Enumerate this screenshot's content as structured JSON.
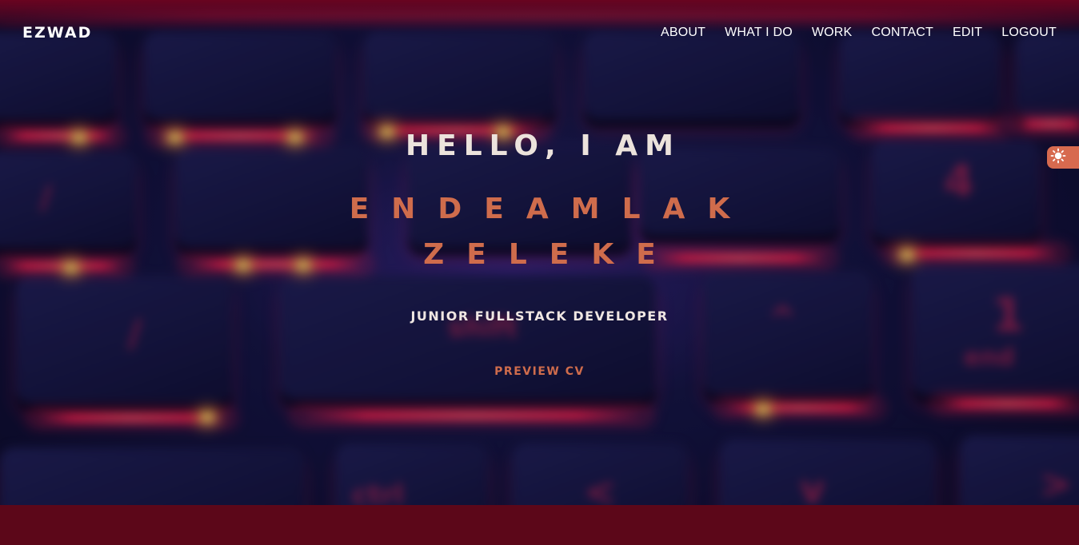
{
  "nav": {
    "brand": "EZWAD",
    "items": [
      {
        "label": "ABOUT"
      },
      {
        "label": "WHAT I DO"
      },
      {
        "label": "WORK"
      },
      {
        "label": "CONTACT"
      },
      {
        "label": "EDIT"
      },
      {
        "label": "LOGOUT"
      }
    ]
  },
  "theme_toggle": {
    "icon": "sun-icon"
  },
  "hero": {
    "greeting": "HELLO, I AM",
    "first_name": "ENDEAMLAK",
    "last_name": "ZELEKE",
    "role": "JUNIOR FULLSTACK DEVELOPER",
    "cta": "PREVIEW CV"
  },
  "colors": {
    "accent": "#cf6c4c",
    "footer_band": "#5c0719",
    "hero_bg": "#15163f"
  }
}
